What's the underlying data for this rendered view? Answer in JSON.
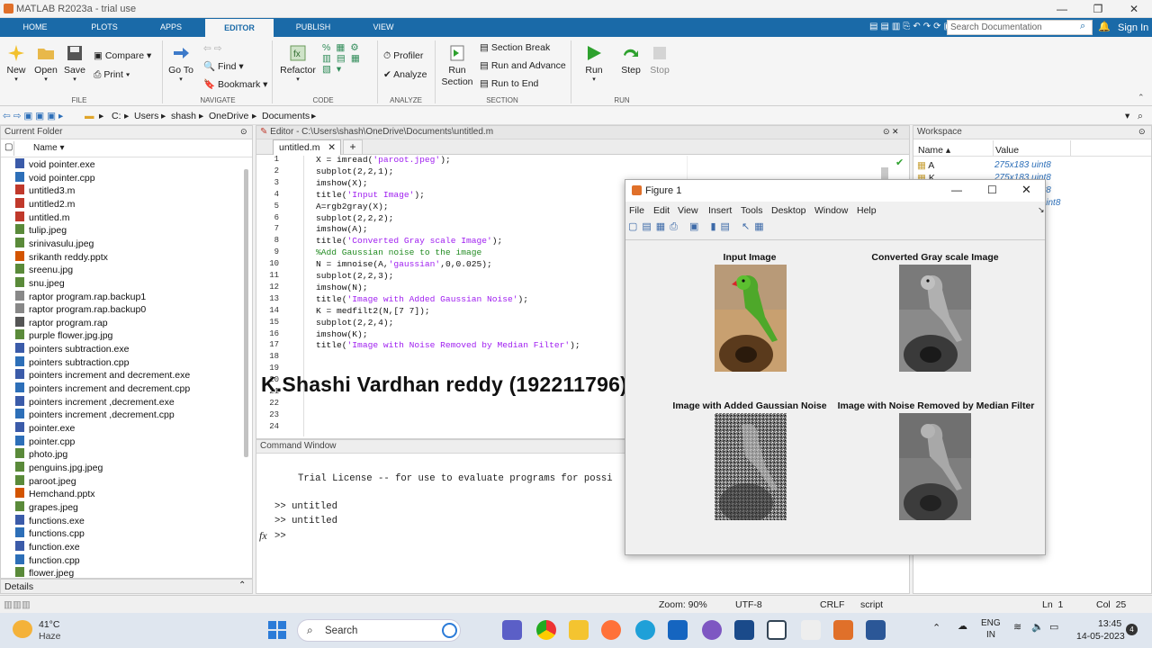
{
  "window": {
    "title": "MATLAB R2023a - trial use",
    "min": "—",
    "max": "❐",
    "close": "✕"
  },
  "tabs": [
    "HOME",
    "PLOTS",
    "APPS",
    "EDITOR",
    "PUBLISH",
    "VIEW"
  ],
  "search_doc": {
    "placeholder": "Search Documentation"
  },
  "signin": "Sign In",
  "ribbon": {
    "file": {
      "new": "New",
      "open": "Open",
      "save": "Save",
      "compare": "Compare",
      "print": "Print",
      "group": "FILE"
    },
    "navigate": {
      "goto": "Go To",
      "find": "Find",
      "bookmark": "Bookmark",
      "group": "NAVIGATE"
    },
    "code": {
      "refactor": "Refactor",
      "group": "CODE"
    },
    "analyze": {
      "profiler": "Profiler",
      "analyze": "Analyze",
      "group": "ANALYZE"
    },
    "section": {
      "run_section": "Run Section",
      "section_break": "Section Break",
      "run_advance": "Run and Advance",
      "run_end": "Run to End",
      "group": "SECTION"
    },
    "run": {
      "run": "Run",
      "step": "Step",
      "stop": "Stop",
      "group": "RUN"
    }
  },
  "address": [
    "C:",
    "Users",
    "shash",
    "OneDrive",
    "Documents"
  ],
  "current_folder": {
    "title": "Current Folder",
    "col": "Name ▾",
    "files": [
      "void pointer.exe",
      "void pointer.cpp",
      "untitled3.m",
      "untitled2.m",
      "untitled.m",
      "tulip.jpeg",
      "srinivasulu.jpeg",
      "srikanth reddy.pptx",
      "sreenu.jpg",
      "snu.jpeg",
      "raptor program.rap.backup1",
      "raptor program.rap.backup0",
      "raptor program.rap",
      "purple flower.jpg.jpg",
      "pointers subtraction.exe",
      "pointers subtraction.cpp",
      "pointers increment and decrement.exe",
      "pointers increment and decrement.cpp",
      "pointers increment ,decrement.exe",
      "pointers increment ,decrement.cpp",
      "pointer.exe",
      "pointer.cpp",
      "photo.jpg",
      "penguins.jpg.jpeg",
      "paroot.jpeg",
      "Hemchand.pptx",
      "grapes.jpeg",
      "functions.exe",
      "functions.cpp",
      "function.exe",
      "function.cpp",
      "flower.jpeg"
    ],
    "details": "Details"
  },
  "editor": {
    "title": "Editor - C:\\Users\\shash\\OneDrive\\Documents\\untitled.m",
    "tab": "untitled.m",
    "add": "+",
    "lines": [
      [
        "1",
        "X = imread(",
        "'paroot.jpeg'",
        ");"
      ],
      [
        "2",
        "subplot(2,2,1);",
        "",
        ""
      ],
      [
        "3",
        "imshow(X);",
        "",
        ""
      ],
      [
        "4",
        "title(",
        "'Input Image'",
        ");"
      ],
      [
        "5",
        "A=rgb2gray(X);",
        "",
        ""
      ],
      [
        "6",
        "subplot(2,2,2);",
        "",
        ""
      ],
      [
        "7",
        "imshow(A);",
        "",
        ""
      ],
      [
        "8",
        "title(",
        "'Converted Gray scale Image'",
        ");"
      ],
      [
        "9",
        "",
        "",
        ""
      ],
      [
        "10",
        "N = imnoise(A,",
        "'gaussian'",
        ",0,0.025);"
      ],
      [
        "11",
        "subplot(2,2,3);",
        "",
        ""
      ],
      [
        "12",
        "imshow(N);",
        "",
        ""
      ],
      [
        "13",
        "title(",
        "'Image with Added Gaussian Noise'",
        ");"
      ],
      [
        "14",
        "K = medfilt2(N,[7 7]);",
        "",
        ""
      ],
      [
        "15",
        "subplot(2,2,4);",
        "",
        ""
      ],
      [
        "16",
        "imshow(K);",
        "",
        ""
      ],
      [
        "17",
        "title(",
        "'Image with Noise Removed by Median Filter'",
        ");"
      ],
      [
        "18",
        "",
        "",
        ""
      ],
      [
        "19",
        "",
        "",
        ""
      ],
      [
        "20",
        "",
        "",
        ""
      ],
      [
        "21",
        "",
        "",
        ""
      ],
      [
        "22",
        "",
        "",
        ""
      ],
      [
        "23",
        "",
        "",
        ""
      ],
      [
        "24",
        "",
        "",
        ""
      ]
    ],
    "comment_line": "%Add Gaussian noise to the image",
    "overlay": "K.Shashi Vardhan reddy (192211796)"
  },
  "command": {
    "title": "Command Window",
    "license": "Trial License -- for use to evaluate programs for possi",
    "lines": [
      ">> untitled",
      ">> untitled"
    ],
    "prompt": ">>",
    "fx": "fx"
  },
  "workspace": {
    "title": "Workspace",
    "col_name": "Name ▴",
    "col_value": "Value",
    "rows": [
      [
        "A",
        "275x183 uint8"
      ],
      [
        "K",
        "275x183 uint8"
      ],
      [
        "N",
        "275x183 uint8"
      ],
      [
        "X",
        "275x183x3 uint8"
      ]
    ]
  },
  "figure": {
    "title": "Figure 1",
    "menu": [
      "File",
      "Edit",
      "View",
      "Insert",
      "Tools",
      "Desktop",
      "Window",
      "Help"
    ],
    "subplots": [
      "Input Image",
      "Converted Gray scale Image",
      "Image with Added Gaussian Noise",
      "Image with Noise Removed by Median Filter"
    ]
  },
  "status": {
    "zoom": "Zoom: 90%",
    "enc": "UTF-8",
    "eol": "CRLF",
    "type": "script",
    "ln": "Ln  1",
    "col": "Col  25"
  },
  "taskbar": {
    "weather_temp": "41°C",
    "weather_desc": "Haze",
    "search": "Search",
    "lang1": "ENG",
    "lang2": "IN",
    "time": "13:45",
    "date": "14-05-2023",
    "badge": "4"
  }
}
